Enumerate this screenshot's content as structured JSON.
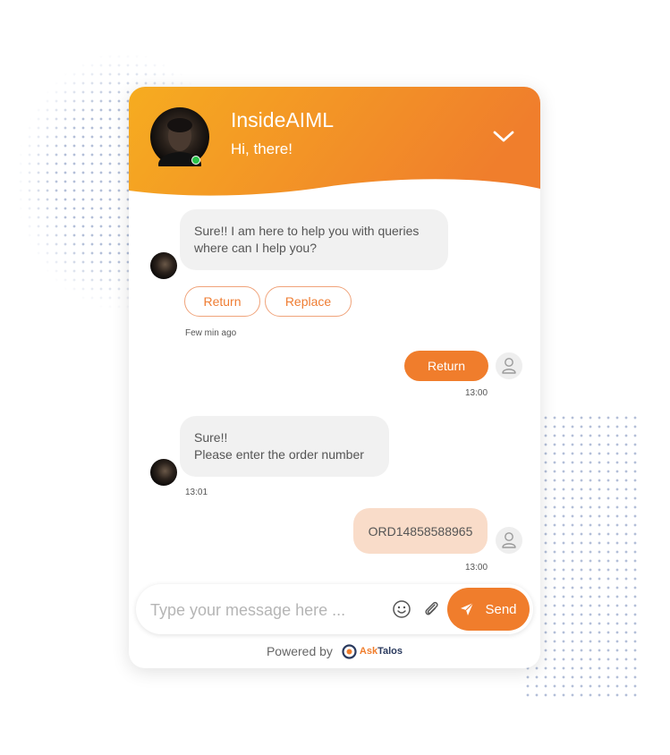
{
  "header": {
    "bot_name": "InsideAIML",
    "greeting": "Hi, there!",
    "status": "online"
  },
  "messages": [
    {
      "sender": "bot",
      "lines": [
        "Sure!! I am here to help you with queries",
        "where can I help you?"
      ],
      "quick_replies": [
        "Return",
        "Replace"
      ],
      "time": "Few min ago"
    },
    {
      "sender": "user",
      "text": "Return",
      "time": "13:00"
    },
    {
      "sender": "bot",
      "lines": [
        "Sure!!",
        "Please enter the order number"
      ],
      "time": "13:01"
    },
    {
      "sender": "user",
      "text": "ORD14858588965",
      "time": "13:00"
    }
  ],
  "composer": {
    "placeholder": "Type your message here ...",
    "send_label": "Send"
  },
  "footer": {
    "powered_by": "Powered by",
    "logo_ask": "Ask",
    "logo_talos": "Talos"
  },
  "colors": {
    "accent": "#f07d2c",
    "header_gradient_start": "#f6ac20",
    "header_gradient_end": "#f07e2c",
    "user_bubble_alt": "#f9dcc9",
    "bot_bubble": "#f1f1f1"
  }
}
